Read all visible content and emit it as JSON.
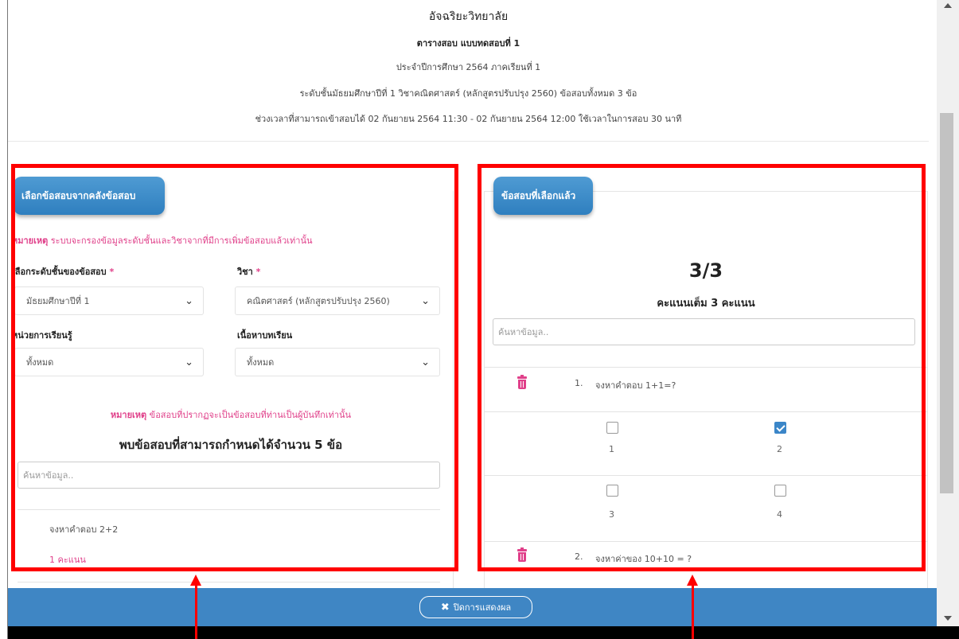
{
  "header": {
    "school": "อัจฉริยะวิทยาลัย",
    "exam_title": "ตารางสอบ แบบทดสอบที่ 1",
    "academic_year": "ประจำปีการศึกษา 2564 ภาคเรียนที่ 1",
    "level_subject": "ระดับชั้นมัธยมศึกษาปีที่ 1 วิชาคณิตศาสตร์ (หลักสูตรปรับปรุง 2560) ข้อสอบทั้งหมด 3 ข้อ",
    "time_window": "ช่วงเวลาที่สามารถเข้าสอบได้ 02 กันยายน 2564 11:30 - 02 กันยายน 2564 12:00 ใช้เวลาในการสอบ 30 นาที"
  },
  "left": {
    "tab_label": "เลือกข้อสอบจากคลังข้อสอบ",
    "note_bold": "หมายเหตุ",
    "note_text": " ระบบจะกรองข้อมูลระดับชั้นและวิชาจากที่มีการเพิ่มข้อสอบแล้วเท่านั้น",
    "level_label": "เลือกระดับชั้นของข้อสอบ",
    "level_value": "มัธยมศึกษาปีที่ 1",
    "subject_label": "วิชา",
    "subject_value": "คณิตศาสตร์ (หลักสูตรปรับปรุง 2560)",
    "unit_label": "หน่วยการเรียนรู้",
    "unit_value": "ทั้งหมด",
    "content_label": "เนื้อหาบทเรียน",
    "content_value": "ทั้งหมด",
    "required_mark": "*",
    "note2_bold": "หมายเหตุ",
    "note2_text": " ข้อสอบที่ปรากฏจะเป็นข้อสอบที่ท่านเป็นผู้บันทึกเท่านั้น",
    "found_text": "พบข้อสอบที่สามารถกำหนดได้จำนวน 5 ข้อ",
    "search_placeholder": "ค้นหาข้อมูล..",
    "question_text": "จงหาคำตอบ 2+2",
    "question_score": "1 คะแนน"
  },
  "right": {
    "tab_label": "ข้อสอบที่เลือกแล้ว",
    "score": "3/3",
    "full_score": "คะแนนเต็ม 3 คะแนน",
    "search_placeholder": "ค้นหาข้อมูล..",
    "q1_num": "1.",
    "q1_text": "จงหาคำตอบ 1+1=?",
    "q1_options": [
      "1",
      "2",
      "3",
      "4"
    ],
    "q1_checked": [
      false,
      true,
      false,
      false
    ],
    "q2_num": "2.",
    "q2_text": "จงหาค่าของ 10+10 = ?"
  },
  "footer": {
    "close_label": "ปิดการแสดงผล"
  },
  "colors": {
    "accent": "#3f86c4",
    "pink": "#e0408a",
    "annotation_red": "#ff0000"
  }
}
